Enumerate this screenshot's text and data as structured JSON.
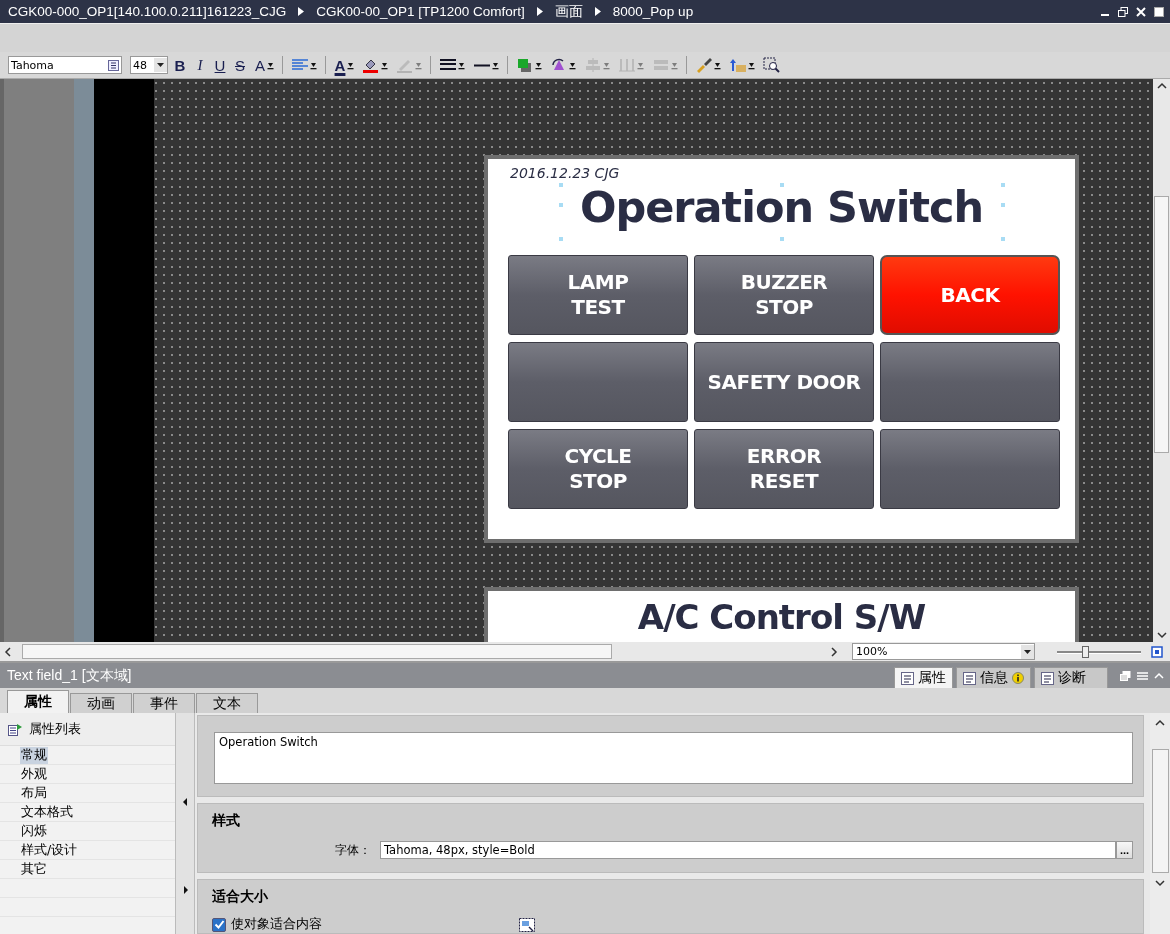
{
  "window": {
    "breadcrumb": [
      "CGK00-000_OP1[140.100.0.211]161223_CJG",
      "CGK00-00_OP1 [TP1200 Comfort]",
      "画面",
      "8000_Pop up"
    ]
  },
  "toolbar": {
    "font": "Tahoma",
    "size": "48",
    "tools": [
      {
        "kind": "bold",
        "label": "B",
        "disabled": false
      },
      {
        "kind": "italic",
        "label": "I",
        "disabled": false
      },
      {
        "kind": "underline",
        "label": "U",
        "disabled": false
      },
      {
        "kind": "strike",
        "label": "S",
        "disabled": false
      },
      {
        "kind": "grow",
        "label": "A",
        "disabled": false
      },
      {
        "kind": "align",
        "disabled": false
      },
      {
        "kind": "font-color",
        "label": "A",
        "disabled": false
      },
      {
        "kind": "fill",
        "disabled": false
      },
      {
        "kind": "pen",
        "disabled": true
      },
      {
        "kind": "line-width",
        "disabled": false
      },
      {
        "kind": "line-style",
        "disabled": false
      },
      {
        "kind": "layer",
        "disabled": false
      },
      {
        "kind": "rotate",
        "disabled": false
      },
      {
        "kind": "align-obj",
        "disabled": true
      },
      {
        "kind": "distribute",
        "disabled": true
      },
      {
        "kind": "size",
        "disabled": true
      },
      {
        "kind": "brush",
        "disabled": false
      },
      {
        "kind": "order",
        "disabled": false
      },
      {
        "kind": "zoom",
        "disabled": false
      }
    ]
  },
  "screen": {
    "date": "2016.12.23 CJG",
    "title": "Operation Switch",
    "buttons": [
      {
        "kind": "normal",
        "label": "LAMP\nTEST"
      },
      {
        "kind": "normal",
        "label": "BUZZER\nSTOP"
      },
      {
        "kind": "alarm",
        "label": "BACK"
      },
      {
        "kind": "normal"
      },
      {
        "kind": "normal",
        "label": "SAFETY DOOR"
      },
      {
        "kind": "normal"
      },
      {
        "kind": "normal",
        "label": "CYCLE\nSTOP"
      },
      {
        "kind": "normal",
        "label": "ERROR\nRESET"
      },
      {
        "kind": "normal"
      }
    ],
    "next_title": "A/C Control S/W"
  },
  "zoom": {
    "value": "100%",
    "level": 0.33
  },
  "inspector": {
    "title": "Text field_1 [文本域]",
    "side_tabs": [
      {
        "label": "属性",
        "selected": true
      },
      {
        "label": "信息",
        "selected": false
      },
      {
        "label": "诊断",
        "selected": false
      }
    ],
    "tabs": [
      {
        "label": "属性",
        "selected": true
      },
      {
        "label": "动画",
        "selected": false
      },
      {
        "label": "事件",
        "selected": false
      },
      {
        "label": "文本",
        "selected": false
      }
    ],
    "list_title": "属性列表",
    "list": [
      {
        "label": "常规",
        "selected": true
      },
      {
        "label": "外观",
        "selected": false
      },
      {
        "label": "布局",
        "selected": false
      },
      {
        "label": "文本格式",
        "selected": false
      },
      {
        "label": "闪烁",
        "selected": false
      },
      {
        "label": "样式/设计",
        "selected": false
      },
      {
        "label": "其它",
        "selected": false
      }
    ],
    "text_value": "Operation Switch",
    "style_section": {
      "title": "样式",
      "font_label": "字体：",
      "font_value": "Tahoma, 48px, style=Bold",
      "browse": "..."
    },
    "fit_section": {
      "title": "适合大小",
      "checkbox": {
        "label": "使对象适合内容",
        "checked": true
      }
    }
  }
}
